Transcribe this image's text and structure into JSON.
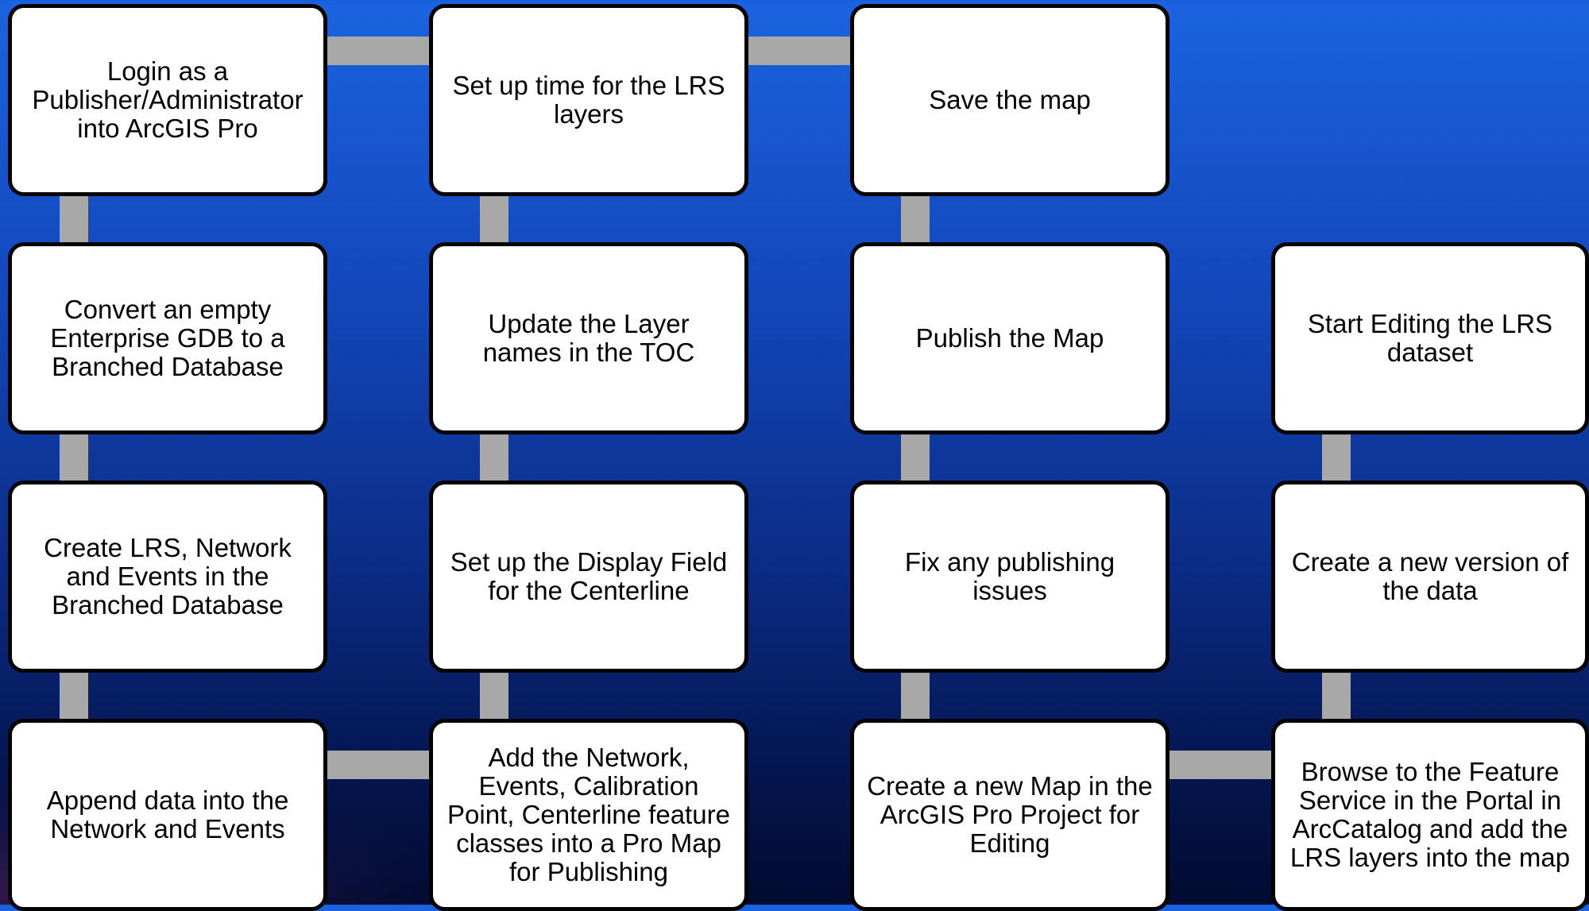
{
  "steps": {
    "col1": [
      "Login as a Publisher/Administrator into ArcGIS Pro",
      "Convert an empty Enterprise GDB to a Branched Database",
      "Create LRS, Network and Events in the Branched Database",
      "Append data into the Network and Events"
    ],
    "col2": [
      "Set up time for the LRS layers",
      "Update the Layer names in the TOC",
      "Set up the Display Field for the Centerline",
      "Add the Network, Events, Calibration Point, Centerline feature classes into a Pro Map for Publishing"
    ],
    "col3": [
      "Save the map",
      "Publish the Map",
      "Fix any publishing issues",
      "Create a new Map in the ArcGIS Pro Project for Editing"
    ],
    "col4": [
      "Start Editing the LRS dataset",
      "Create a new version of the data",
      "Browse to the Feature Service in the Portal in ArcCatalog and add the LRS layers into the map"
    ]
  },
  "colors": {
    "background_top": "#1a63e0",
    "background_bottom": "#020b30",
    "box_fill": "#ffffff",
    "box_border": "#000000",
    "connector": "#a8a8a8"
  }
}
